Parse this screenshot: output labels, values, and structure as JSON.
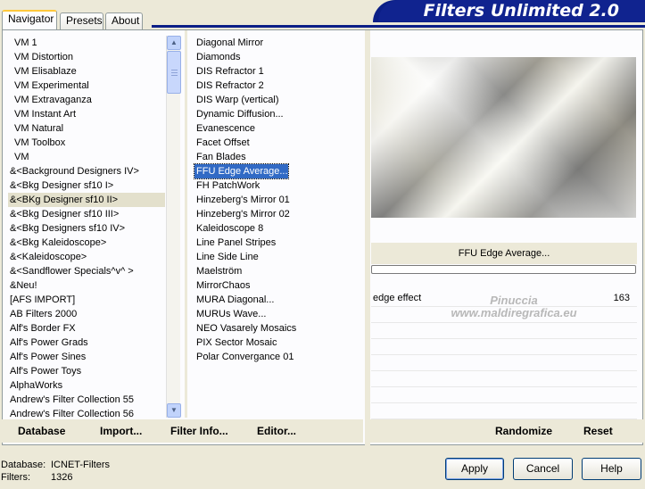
{
  "tabs": [
    "Navigator",
    "Presets",
    "About"
  ],
  "banner_title": "Filters Unlimited 2.0",
  "categories": [
    "VM 1",
    "VM Distortion",
    "VM Elisablaze",
    "VM Experimental",
    "VM Extravaganza",
    "VM Instant Art",
    "VM Natural",
    "VM Toolbox",
    "VM",
    "&<Background Designers IV>",
    "&<Bkg Designer sf10 I>",
    "&<BKg Designer sf10 II>",
    "&<Bkg Designer sf10 III>",
    "&<Bkg Designers sf10 IV>",
    "&<Bkg Kaleidoscope>",
    "&<Kaleidoscope>",
    "&<Sandflower Specials^v^ >",
    "&Neu!",
    "[AFS IMPORT]",
    "AB Filters 2000",
    "Alf's Border FX",
    "Alf's Power Grads",
    "Alf's Power Sines",
    "Alf's Power Toys",
    "AlphaWorks",
    "Andrew's Filter Collection 55",
    "Andrew's Filter Collection 56"
  ],
  "selected_category_index": 11,
  "filters": [
    "Diagonal Mirror",
    "Diamonds",
    "DIS Refractor 1",
    "DIS Refractor 2",
    "DIS Warp (vertical)",
    "Dynamic Diffusion...",
    "Evanescence",
    "Facet Offset",
    "Fan Blades",
    "FFU Edge Average...",
    "FH PatchWork",
    "Hinzeberg's Mirror 01",
    "Hinzeberg's Mirror 02",
    "Kaleidoscope 8",
    "Line Panel Stripes",
    "Line Side Line",
    "Maelström",
    "MirrorChaos",
    "MURA Diagonal...",
    "MURUs Wave...",
    "NEO Vasarely Mosaics",
    "PIX Sector Mosaic",
    "Polar Convergance 01"
  ],
  "selected_filter_index": 9,
  "filter_name": "FFU Edge Average...",
  "params": [
    {
      "name": "edge effect",
      "value": "163"
    }
  ],
  "empty_param_rows": 7,
  "watermark": {
    "line1": "Pinuccia",
    "line2": "www.maldiregrafica.eu"
  },
  "left_buttons": [
    "Database",
    "Import...",
    "Filter Info...",
    "Editor..."
  ],
  "right_buttons": [
    "Randomize",
    "Reset"
  ],
  "status": {
    "database_label": "Database:",
    "database_value": "ICNET-Filters",
    "filters_label": "Filters:",
    "filters_value": "1326"
  },
  "dialog_buttons": [
    "Apply",
    "Cancel",
    "Help"
  ]
}
